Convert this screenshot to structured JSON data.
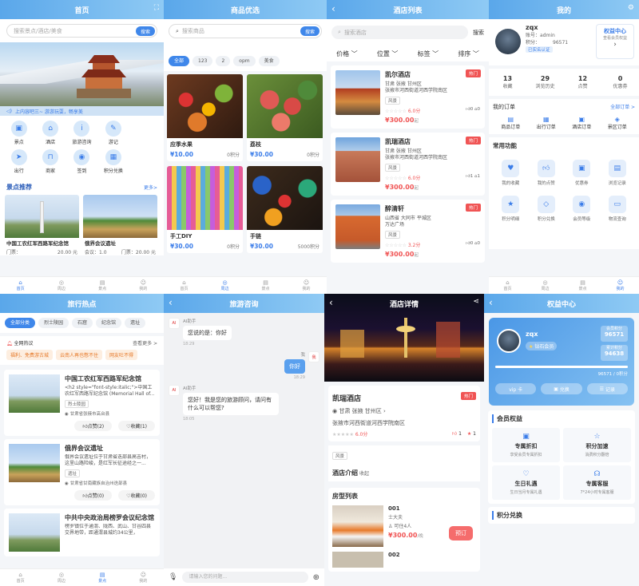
{
  "s1": {
    "title": "首页",
    "search_ph": "搜索景点/酒店/美食",
    "search_btn": "搜索",
    "marquee": "上内容吧三~ 游游玩耍，畅享美",
    "grid": [
      {
        "icon": "image-icon",
        "g": "▣",
        "label": "景点"
      },
      {
        "icon": "home-icon",
        "g": "⌂",
        "label": "酒店"
      },
      {
        "icon": "info-icon",
        "g": "i",
        "label": "旅游咨询"
      },
      {
        "icon": "edit-icon",
        "g": "✎",
        "label": "游记"
      },
      {
        "icon": "none",
        "g": "",
        "label": ""
      },
      {
        "icon": "send-icon",
        "g": "➤",
        "label": "出行"
      },
      {
        "icon": "cart-icon",
        "g": "⊓",
        "label": "商家"
      },
      {
        "icon": "pin-icon",
        "g": "◉",
        "label": "签到"
      },
      {
        "icon": "grid-icon",
        "g": "▦",
        "label": "积分兑换"
      },
      {
        "icon": "none",
        "g": "",
        "label": ""
      }
    ],
    "sec_title": "景点推荐",
    "sec_more": "更多>",
    "spots": [
      {
        "name": "中国工农红军西路军纪念馆",
        "m1": "门票：",
        "m2": "20.00 元"
      },
      {
        "name": "俄界会议遗址",
        "m1": "会议：1.0",
        "m2": "门票：20.00 元"
      }
    ],
    "tabs": [
      "首页",
      "周边",
      "景点",
      "我的"
    ]
  },
  "s2": {
    "title": "商品优选",
    "search_ph": "搜索商品",
    "search_btn": "搜索",
    "pills": [
      "全部",
      "123",
      "2",
      "opm",
      "美食"
    ],
    "items": [
      {
        "name": "应季水果",
        "price": "¥10.00",
        "sold": "0积分"
      },
      {
        "name": "荔枝",
        "price": "¥30.00",
        "sold": "0积分"
      },
      {
        "name": "手工DIY",
        "price": "¥30.00",
        "sold": "0积分"
      },
      {
        "name": "手链",
        "price": "¥30.00",
        "sold": "5000积分"
      }
    ],
    "tabs": [
      "首页",
      "周边",
      "景点",
      "我的"
    ]
  },
  "s3": {
    "title": "酒店列表",
    "search_ph": "搜索酒店",
    "search_btn": "搜索",
    "filters": [
      "价格",
      "位置",
      "标签",
      "排序"
    ],
    "hotels": [
      {
        "name": "凯尔酒店",
        "a1": "甘肃 张掖 甘州区",
        "a2": "张掖市河西街道河西学院南区",
        "tag": "风景",
        "score": "6.0分",
        "price": "¥300.00",
        "unit": "起",
        "hot": "热门",
        "l": "0",
        "f": "0"
      },
      {
        "name": "凯瑞酒店",
        "a1": "甘肃 张掖 甘州区",
        "a2": "张掖市河西街道河西学院南区",
        "tag": "风景",
        "score": "6.0分",
        "price": "¥300.00",
        "unit": "起",
        "hot": "热门",
        "l": "1",
        "f": "1"
      },
      {
        "name": "醉清轩",
        "a1": "山西省 大同市 平城区",
        "a2": "万达广场",
        "tag": "风景",
        "score": "3.2分",
        "price": "¥300.00",
        "unit": "起",
        "hot": "热门",
        "l": "0",
        "f": "0"
      }
    ]
  },
  "s4": {
    "title": "我的",
    "name": "zqx",
    "acct": "账号：admin",
    "pts": "积分：",
    "ptsv": "96571",
    "verified": "已实名认证",
    "vip": "权益中心",
    "vip_sub": "查看会员权益",
    "stats": [
      {
        "n": "13",
        "l": "收藏"
      },
      {
        "n": "29",
        "l": "浏览历史"
      },
      {
        "n": "12",
        "l": "点赞"
      },
      {
        "n": "0",
        "l": "优惠券"
      }
    ],
    "orders_title": "我的订单",
    "orders_all": "全部订单 >",
    "orders": [
      "商品订单",
      "出行订单",
      "酒店订单",
      "景区订单"
    ],
    "func_title": "常用功能",
    "funcs": [
      "我的收藏",
      "我的点赞",
      "优惠券",
      "浏览记录",
      "积分明细",
      "积分兑换",
      "会员等级",
      "物流查询"
    ],
    "tabs": [
      "首页",
      "周边",
      "景点",
      "我的"
    ]
  },
  "s5": {
    "title": "旅行热点",
    "pills": [
      "全部分类",
      "烈士陵园",
      "石窟",
      "纪念馆",
      "遗址"
    ],
    "hot_title": "全网热议",
    "hot_more": "查看更多 >",
    "hot_tags": [
      "福利、免费游古城",
      "云南人再也憋不住",
      "网友吐不得"
    ],
    "posts": [
      {
        "title": "中国工农红军西路军纪念馆",
        "desc": "<h2 style=\"font-style:italic;\">中国工农红军西路军纪念馆 (Memorial Hall of...",
        "tag": "烈士陵园",
        "loc": "甘肃省张掖市高台县",
        "like": "点赞(2)",
        "fav": "收藏(1)"
      },
      {
        "title": "俄界会议遗址",
        "desc": "俄界会议遗址位于甘肃省迭部县高吉村，这里山路险峻，是红军长征途经之一...",
        "tag": "遗址",
        "loc": "甘肃省甘南藏族自治州迭部县",
        "like": "点赞(0)",
        "fav": "收藏(0)"
      },
      {
        "title": "中共中央政治局榜罗会议纪念馆",
        "desc": "榜罗镇位于通渭、陇西、武山、甘谷四县交界地带，距通渭县城约34公里，"
      }
    ],
    "tabs": [
      "首页",
      "周边",
      "景点",
      "我的"
    ]
  },
  "s6": {
    "title": "旅游咨询",
    "bot": "AI助手",
    "me": "我",
    "m1": "您说的是：你好",
    "t1": "18:29",
    "m2": "你好",
    "t2": "18:29",
    "m3": "您好！我是您的旅游顾问，请问有什么可以帮您?",
    "t3": "18:05",
    "input_ph": "请输入您的问题..."
  },
  "s7": {
    "title": "酒店详情",
    "name": "凯瑞酒店",
    "hot": "热门",
    "addr1": "甘肃 张掖 甘州区",
    "addr2": "张掖市河西街道河西学院南区",
    "score": "6.0分",
    "likes": "1",
    "favs": "1",
    "tag": "风景",
    "intro": "酒店介绍",
    "intro_s": "收起",
    "rooms_title": "房型列表",
    "rooms": [
      {
        "no": "001",
        "type": "士大夫",
        "cap": "可住4人",
        "price": "¥300.00",
        "unit": "/晚",
        "btn": "预订"
      },
      {
        "no": "002"
      }
    ]
  },
  "s8": {
    "title": "权益中心",
    "name": "zqx",
    "level": "钻石会员",
    "c1l": "会员积分",
    "c1": "96571",
    "c2l": "累计积分",
    "c2": "94638",
    "progress": "96571 / 0积分",
    "progress_frac": 1.0,
    "b1": "vip 卡",
    "b2": "兑换",
    "b3": "记录",
    "ben_title": "会员权益",
    "bens": [
      {
        "t": "专属折扣",
        "s": "享受会员专属折扣"
      },
      {
        "t": "积分加速",
        "s": "消费积分翻倍"
      },
      {
        "t": "生日礼遇",
        "s": "生日当月专属礼遇"
      },
      {
        "t": "专属客服",
        "s": "7*24小时专属客服"
      }
    ],
    "ex_title": "积分兑换"
  }
}
